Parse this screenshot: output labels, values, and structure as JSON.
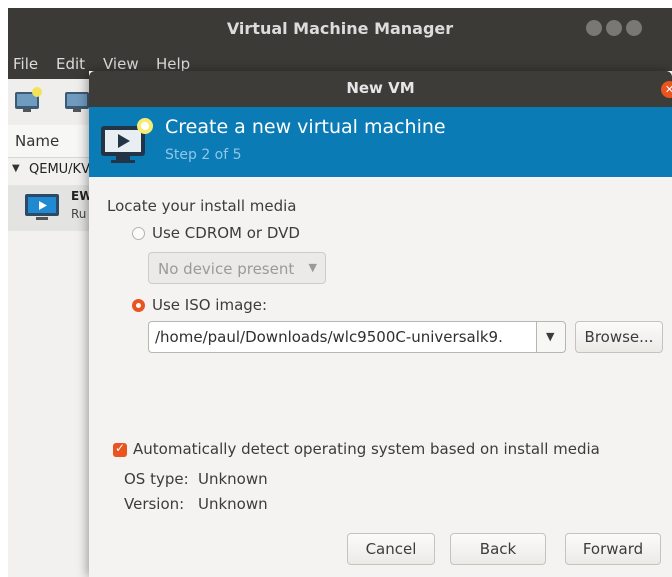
{
  "main_window": {
    "title": "Virtual Machine Manager",
    "menu": [
      "File",
      "Edit",
      "View",
      "Help"
    ],
    "list_header": "Name",
    "group_label": "QEMU/KV",
    "vm_row": {
      "name": "EW",
      "state": "Ru"
    }
  },
  "dialog": {
    "title": "New VM",
    "heading": "Create a new virtual machine",
    "step": "Step 2 of 5",
    "section_label": "Locate your install media",
    "cdrom": {
      "label": "Use CDROM or DVD",
      "selected": false,
      "combo_value": "No device present"
    },
    "iso": {
      "label": "Use ISO image:",
      "selected": true,
      "path": "/home/paul/Downloads/wlc9500C-universalk9.",
      "browse_label": "Browse..."
    },
    "auto_detect": {
      "label": "Automatically detect operating system based on install media",
      "checked": true
    },
    "os_type": {
      "label": "OS type:",
      "value": "Unknown"
    },
    "version": {
      "label": "Version:",
      "value": "Unknown"
    },
    "buttons": {
      "cancel": "Cancel",
      "back": "Back",
      "forward": "Forward"
    }
  },
  "colors": {
    "accent": "#e95420",
    "header_bg": "#0b7bb6",
    "titlebar": "#3b3a36"
  }
}
